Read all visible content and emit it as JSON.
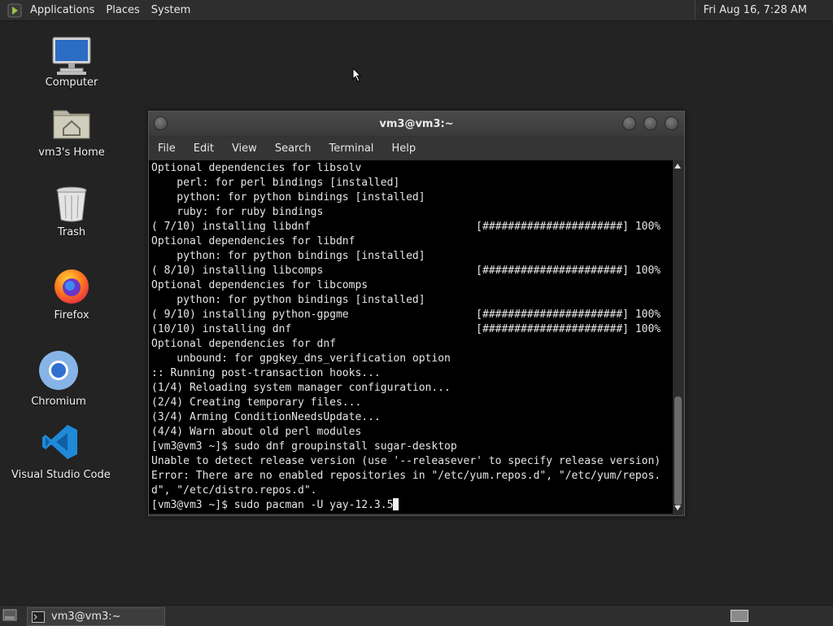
{
  "top_panel": {
    "menus": [
      "Applications",
      "Places",
      "System"
    ],
    "clock": "Fri Aug 16,  7:28 AM"
  },
  "desktop": {
    "icons": [
      {
        "label": "Computer",
        "icon": "computer-icon"
      },
      {
        "label": "vm3's Home",
        "icon": "home-folder-icon"
      },
      {
        "label": "Trash",
        "icon": "trash-icon"
      },
      {
        "label": "Firefox",
        "icon": "firefox-icon"
      },
      {
        "label": "Chromium",
        "icon": "chromium-icon"
      },
      {
        "label": "Visual Studio Code",
        "icon": "vscode-icon"
      }
    ]
  },
  "window": {
    "title": "vm3@vm3:~",
    "menu": [
      "File",
      "Edit",
      "View",
      "Search",
      "Terminal",
      "Help"
    ],
    "lines": [
      "Optional dependencies for libsolv",
      "    perl: for perl bindings [installed]",
      "    python: for python bindings [installed]",
      "    ruby: for ruby bindings",
      "( 7/10) installing libdnf                          [######################] 100%",
      "Optional dependencies for libdnf",
      "    python: for python bindings [installed]",
      "( 8/10) installing libcomps                        [######################] 100%",
      "Optional dependencies for libcomps",
      "    python: for python bindings [installed]",
      "( 9/10) installing python-gpgme                    [######################] 100%",
      "(10/10) installing dnf                             [######################] 100%",
      "Optional dependencies for dnf",
      "    unbound: for gpgkey_dns_verification option",
      ":: Running post-transaction hooks...",
      "(1/4) Reloading system manager configuration...",
      "(2/4) Creating temporary files...",
      "(3/4) Arming ConditionNeedsUpdate...",
      "(4/4) Warn about old perl modules",
      "[vm3@vm3 ~]$ sudo dnf groupinstall sugar-desktop",
      "Unable to detect release version (use '--releasever' to specify release version)",
      "Error: There are no enabled repositories in \"/etc/yum.repos.d\", \"/etc/yum/repos.",
      "d\", \"/etc/distro.repos.d\"."
    ],
    "prompt_line": "[vm3@vm3 ~]$ sudo pacman -U yay-12.3.5"
  },
  "bottom_panel": {
    "task_label": "vm3@vm3:~"
  },
  "colors": {
    "desktop_bg": "#232323",
    "panel_bg": "#2e2e2e",
    "terminal_bg": "#000000",
    "terminal_fg": "#e6e6e6"
  }
}
